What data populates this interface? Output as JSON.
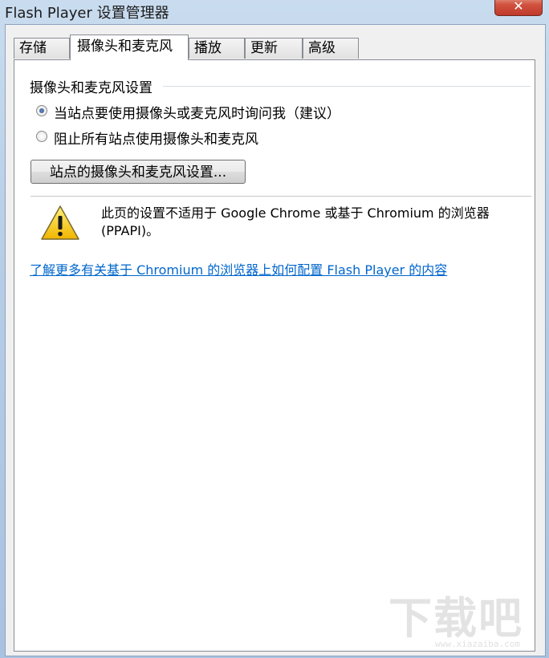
{
  "window": {
    "title": "Flash Player 设置管理器",
    "close_label": "✕"
  },
  "tabs": [
    {
      "label": "存储"
    },
    {
      "label": "摄像头和麦克风"
    },
    {
      "label": "播放"
    },
    {
      "label": "更新"
    },
    {
      "label": "高级"
    }
  ],
  "active_tab": "摄像头和麦克风",
  "group": {
    "title": "摄像头和麦克风设置"
  },
  "options": [
    {
      "label": "当站点要使用摄像头或麦克风时询问我（建议）",
      "checked": true
    },
    {
      "label": "阻止所有站点使用摄像头和麦克风",
      "checked": false
    }
  ],
  "site_settings_button": "站点的摄像头和麦克风设置...",
  "warning": {
    "icon": "warning-icon",
    "text": "此页的设置不适用于 Google Chrome 或基于 Chromium 的浏览器 (PPAPI)。"
  },
  "help_link": "了解更多有关基于 Chromium 的浏览器上如何配置 Flash Player 的内容",
  "watermark": {
    "text": "下载吧",
    "sub": "www.xiazaiba.com"
  }
}
